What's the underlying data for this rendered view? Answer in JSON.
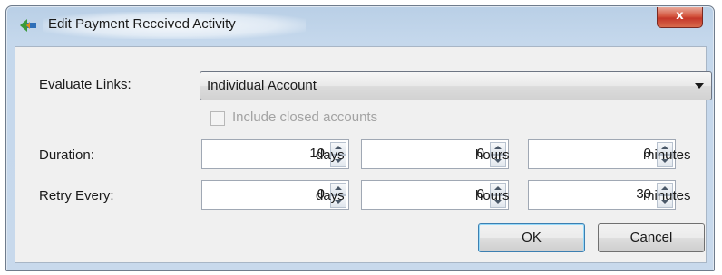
{
  "window": {
    "title": "Edit Payment Received Activity",
    "close_label": "x"
  },
  "evaluate_links": {
    "label": "Evaluate Links:",
    "selected": "Individual Account"
  },
  "include_closed": {
    "label": "Include closed accounts",
    "checked": false,
    "enabled": false
  },
  "duration": {
    "label": "Duration:",
    "days": "10",
    "hours": "0",
    "minutes": "0"
  },
  "retry_every": {
    "label": "Retry Every:",
    "days": "0",
    "hours": "0",
    "minutes": "30"
  },
  "units": {
    "days": "days",
    "hours": "hours",
    "minutes": "minutes"
  },
  "buttons": {
    "ok": "OK",
    "cancel": "Cancel"
  },
  "colors": {
    "frame": "#c5d8ec",
    "client": "#f0f0f0",
    "close": "#c4382a",
    "default_border": "#3c7fb1"
  },
  "icons": {
    "app": "payment-activity-icon",
    "dropdown": "chevron-down-icon",
    "spin_up": "spin-up-icon",
    "spin_down": "spin-down-icon"
  }
}
